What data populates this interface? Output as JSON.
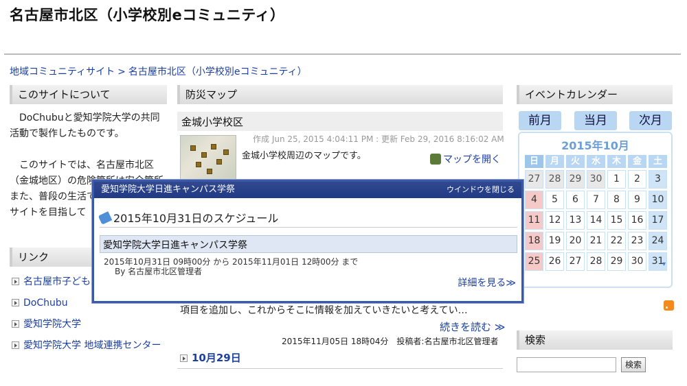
{
  "site": {
    "title": "名古屋市北区（小学校別eコミュニティ）"
  },
  "breadcrumb": {
    "items": [
      "地域コミュニティサイト",
      "名古屋市北区（小学校別eコミュニティ）"
    ],
    "separator": ">"
  },
  "about": {
    "heading": "このサイトについて",
    "paragraph1": "DoChubuと愛知学院大学の共同活動で製作したものです。",
    "paragraph2": "このサイトでは、名古屋市北区（金城地区）の危険箇所は安全箇所また、普段の生活でき情報を載せ、サイトを目指して"
  },
  "links": {
    "heading": "リンク",
    "items": [
      "名古屋市子ども・センター 赤ち",
      "DoChubu",
      "愛知学院大学",
      "愛知学院大学 地域連携センター"
    ]
  },
  "map": {
    "heading": "防災マップ",
    "post_title": "金城小学校区",
    "post_meta": "作成 Jun 25, 2015 4:04:11 PM : 更新 Feb 29, 2016 8:16:02 AM",
    "post_summary": "金城小学校周辺のマップです。",
    "open_map": "マップを開く"
  },
  "post2": {
    "text": "項目を追加し、これからそこに情報を加えていきたいと考えてい…",
    "read_more": "続きを読む ≫",
    "meta": "2015年11月05日 18時04分　投稿者:名古屋市北区管理者"
  },
  "post3": {
    "title": "10月29日"
  },
  "calendar": {
    "heading": "イベントカレンダー",
    "prev": "前月",
    "current": "当月",
    "next": "次月",
    "month_title": "2015年10月",
    "weekdays": [
      "日",
      "月",
      "火",
      "水",
      "木",
      "金",
      "土"
    ],
    "days": [
      {
        "d": "27",
        "t": "other"
      },
      {
        "d": "28",
        "t": "other"
      },
      {
        "d": "29",
        "t": "other"
      },
      {
        "d": "30",
        "t": "other"
      },
      {
        "d": "1",
        "t": ""
      },
      {
        "d": "2",
        "t": ""
      },
      {
        "d": "3",
        "t": "sat"
      },
      {
        "d": "4",
        "t": "sun"
      },
      {
        "d": "5",
        "t": ""
      },
      {
        "d": "6",
        "t": ""
      },
      {
        "d": "7",
        "t": ""
      },
      {
        "d": "8",
        "t": ""
      },
      {
        "d": "9",
        "t": ""
      },
      {
        "d": "10",
        "t": "sat"
      },
      {
        "d": "11",
        "t": "sun"
      },
      {
        "d": "12",
        "t": ""
      },
      {
        "d": "13",
        "t": ""
      },
      {
        "d": "14",
        "t": ""
      },
      {
        "d": "15",
        "t": ""
      },
      {
        "d": "16",
        "t": ""
      },
      {
        "d": "17",
        "t": "sat"
      },
      {
        "d": "18",
        "t": "sun"
      },
      {
        "d": "19",
        "t": ""
      },
      {
        "d": "20",
        "t": ""
      },
      {
        "d": "21",
        "t": ""
      },
      {
        "d": "22",
        "t": ""
      },
      {
        "d": "23",
        "t": ""
      },
      {
        "d": "24",
        "t": "sat"
      },
      {
        "d": "25",
        "t": "sun"
      },
      {
        "d": "26",
        "t": ""
      },
      {
        "d": "27",
        "t": ""
      },
      {
        "d": "28",
        "t": ""
      },
      {
        "d": "29",
        "t": ""
      },
      {
        "d": "30",
        "t": ""
      },
      {
        "d": "31",
        "t": "sat event"
      }
    ]
  },
  "search": {
    "heading": "検索",
    "button": "検索",
    "value": ""
  },
  "popup": {
    "window_title": "愛知学院大学日進キャンパス学祭",
    "close": "ウインドウを閉じる",
    "heading": "2015年10月31日のスケジュール",
    "event_title": "愛知学院大学日進キャンパス学祭",
    "time": "2015年10月31日 09時00分 から 2015年11月01日 12時00分 まで",
    "author": "By 名古屋市北区管理者",
    "detail": "詳細を見る≫"
  },
  "colors": {
    "link": "#1a3fa0",
    "popup_header": "#2b4290",
    "calendar_accent": "#b9d6f2"
  }
}
